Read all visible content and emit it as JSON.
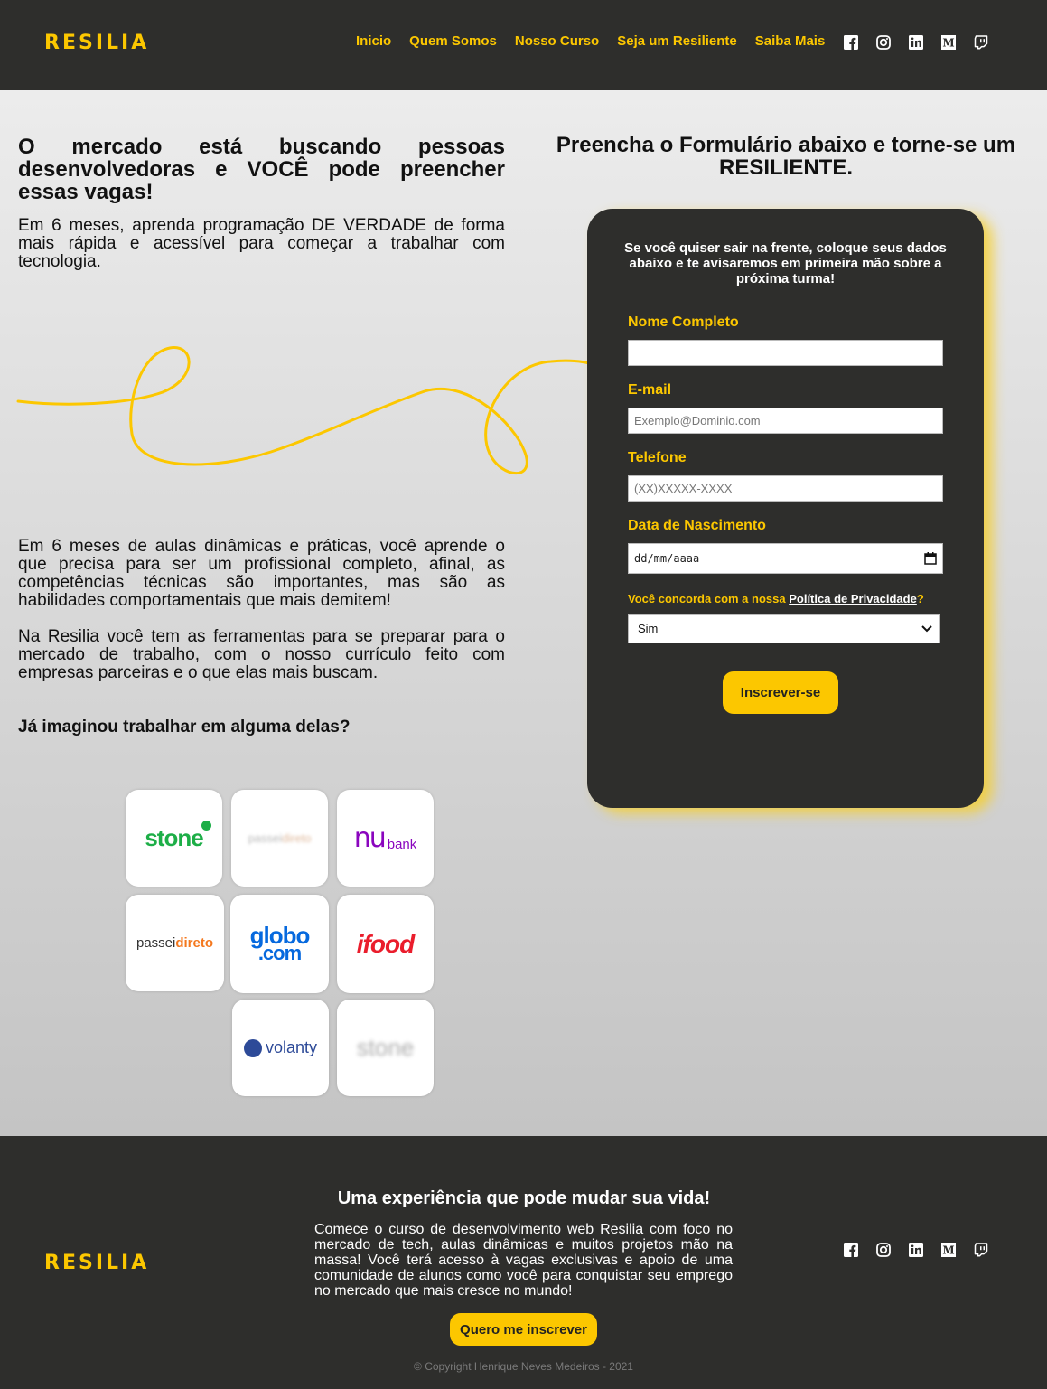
{
  "header": {
    "logo": "RESILIA",
    "nav": [
      "Inicio",
      "Quem Somos",
      "Nosso Curso",
      "Seja um Resiliente",
      "Saiba Mais"
    ],
    "social_icons": [
      "facebook-icon",
      "instagram-icon",
      "linkedin-icon",
      "medium-icon",
      "twitch-icon"
    ]
  },
  "main": {
    "headline": "O mercado está buscando pessoas desenvolvedoras e VOCÊ pode preencher essas vagas!",
    "intro": "Em 6 meses, aprenda programação DE VERDADE de forma mais rápida e acessível para começar a trabalhar com tecnologia.",
    "paragraph1": "Em 6 meses de aulas dinâmicas e práticas, você aprende o que precisa para ser um profissional completo, afinal, as competências técnicas são importantes, mas são as habilidades comportamentais que mais demitem!",
    "paragraph2": "Na Resilia você tem as ferramentas para se preparar para o mercado de trabalho, com o nosso currículo feito com empresas parceiras e o que elas mais buscam.",
    "companies_title": "Já imaginou trabalhar em alguma delas?",
    "companies": [
      "stone",
      "passeidireto",
      "nubank",
      "passeidireto",
      "globo.com",
      "ifood",
      "volanty",
      "stone"
    ],
    "logo_text": {
      "stone": "stone",
      "nu": "nu",
      "bank": "bank",
      "passei": "passei",
      "direto": "direto",
      "globo": "globo",
      "com": ".com",
      "ifood": "ifood",
      "volanty": "volanty"
    }
  },
  "form": {
    "title": "Preencha o Formulário abaixo e torne-se um RESILIENTE.",
    "intro": "Se você quiser sair na frente, coloque seus dados abaixo e te avisaremos em primeira mão sobre a próxima turma!",
    "name_label": "Nome Completo",
    "name_value": "",
    "email_label": "E-mail",
    "email_placeholder": "Exemplo@Dominio.com",
    "phone_label": "Telefone",
    "phone_placeholder": "(XX)XXXXX-XXXX",
    "birth_label": "Data de Nascimento",
    "birth_placeholder": "dd/mm/aaaa",
    "privacy_prefix": "Você concorda com a nossa ",
    "privacy_link": "Política de Privacidade",
    "privacy_suffix": "?",
    "privacy_selected": "Sim",
    "submit": "Inscrever-se"
  },
  "footer": {
    "logo": "RESILIA",
    "title": "Uma experiência que pode mudar sua vida!",
    "text": "Comece o curso de desenvolvimento web Resilia com foco no mercado de tech, aulas dinâmicas e muitos projetos mão na massa! Você terá acesso à vagas exclusivas e apoio de uma comunidade de alunos como você para conquistar seu emprego no mercado que mais cresce no mundo!",
    "cta": "Quero me inscrever",
    "copyright": "© Copyright Henrique Neves Medeiros - 2021"
  },
  "colors": {
    "accent": "#fcc700",
    "dark": "#2e2e2c",
    "stone": "#1dae47",
    "nubank": "#8a05be",
    "passeidireto": "#f4781e",
    "globo": "#0669de",
    "ifood": "#ea1d2c",
    "volanty": "#2d4a98"
  }
}
